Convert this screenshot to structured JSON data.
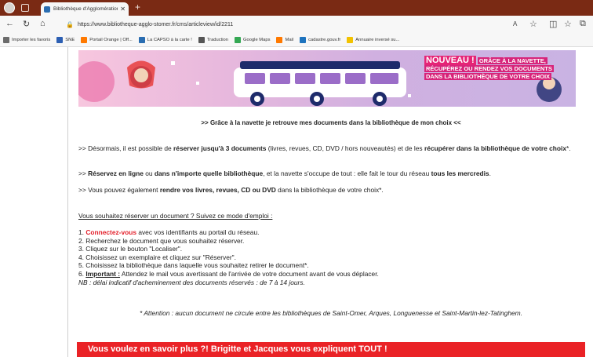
{
  "browser": {
    "tab_title": "Bibliothèque d'Agglomération de",
    "new_tab": "+",
    "url": "https://www.bibliotheque-agglo-stomer.fr/cms/articleview/id/2211",
    "bookmarks": [
      {
        "label": "Importer les favoris",
        "color": "#6b6b6b"
      },
      {
        "label": "SNE",
        "color": "#2c5fb3"
      },
      {
        "label": "Portail Orange | Off...",
        "color": "#ff7900"
      },
      {
        "label": "La CAPSO à la carte !",
        "color": "#2a6db1"
      },
      {
        "label": "Traduction",
        "color": "#555555"
      },
      {
        "label": "Google Maps",
        "color": "#34a853"
      },
      {
        "label": "Mail",
        "color": "#ff7900"
      },
      {
        "label": "cadastre.gouv.fr",
        "color": "#1e73be"
      },
      {
        "label": "Annuaire inversé su...",
        "color": "#f2c200"
      }
    ]
  },
  "banner": {
    "word_big": "NOUVEAU !",
    "line1": "GRÂCE À LA NAVETTE,",
    "line2": "RÉCUPÉREZ OU RENDEZ VOS DOCUMENTS",
    "line3": "DANS LA BIBLIOTHÈQUE DE VOTRE CHOIX"
  },
  "article": {
    "subtitle": ">> Grâce à la navette je retrouve mes documents dans la bibliothèque de mon choix <<",
    "p1_a": ">> Désormais, il est possible de ",
    "p1_b": "réserver jusqu'à 3 documents",
    "p1_c": " (livres, revues, CD, DVD / hors nouveautés) et de les ",
    "p1_d": "récupérer dans la bibliothèque de votre choix",
    "p1_e": "*.",
    "p2_a": ">> ",
    "p2_b": "Réservez en ligne",
    "p2_c": " ou ",
    "p2_d": "dans n'importe quelle bibliothèque",
    "p2_e": ", et la navette s'occupe de tout : elle fait le tour du réseau ",
    "p2_f": "tous les mercredis",
    "p2_g": ".",
    "p3_a": ">> Vous pouvez également ",
    "p3_b": "rendre vos livres, revues, CD ou DVD",
    "p3_c": " dans la bibliothèque de votre choix*.",
    "howto": "Vous souhaitez réserver un document ? Suivez ce mode d'emploi :",
    "step1_a": "1. ",
    "step1_link": "Connectez-vous",
    "step1_b": " avec vos identifiants au portail du réseau.",
    "step2": "2. Recherchez le document que vous souhaitez réserver.",
    "step3": "3. Cliquez sur le bouton \"Localiser\".",
    "step4": "4. Choisissez un exemplaire et cliquez sur \"Réserver\".",
    "step5": "5. Choisissez la bibliothèque dans laquelle vous souhaitez retirer le document*.",
    "step6_a": "6. ",
    "step6_b": "Important :",
    "step6_c": " Attendez le mail vous avertissant de l'arrivée de votre document avant de vous déplacer.",
    "nb": "NB : délai indicatif d'acheminement des documents réservés : de 7 à 14 jours.",
    "notice": "* Attention : aucun document ne circule entre les bibliothèques de Saint-Omer, Arques, Longuenesse et Saint-Martin-lez-Tatinghem.",
    "video_banner": "Vous voulez en savoir plus ?! Brigitte et Jacques vous expliquent TOUT !"
  }
}
